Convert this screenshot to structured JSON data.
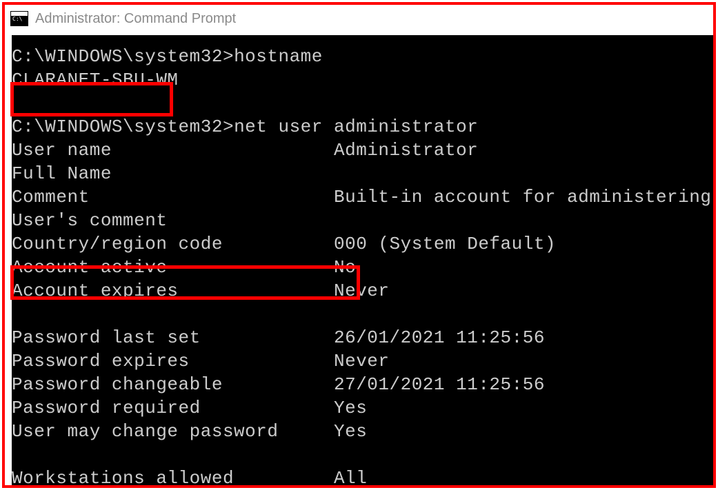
{
  "window": {
    "title": "Administrator: Command Prompt"
  },
  "prompt": "C:\\WINDOWS\\system32>",
  "cmd1": "hostname",
  "hostname": "CLARANET-SBU-WM",
  "cmd2": "net user administrator",
  "fields": {
    "user_name_label": "User name",
    "user_name_value": "Administrator",
    "full_name_label": "Full Name",
    "full_name_value": "",
    "comment_label": "Comment",
    "comment_value": "Built-in account for administering",
    "users_comment_label": "User's comment",
    "users_comment_value": "",
    "country_label": "Country/region code",
    "country_value": "000 (System Default)",
    "account_active_label": "Account active",
    "account_active_value": "No",
    "account_expires_label": "Account expires",
    "account_expires_value": "Never",
    "pw_last_set_label": "Password last set",
    "pw_last_set_value": "26/01/2021 11:25:56",
    "pw_expires_label": "Password expires",
    "pw_expires_value": "Never",
    "pw_changeable_label": "Password changeable",
    "pw_changeable_value": "27/01/2021 11:25:56",
    "pw_required_label": "Password required",
    "pw_required_value": "Yes",
    "user_may_change_label": "User may change password",
    "user_may_change_value": "Yes",
    "workstations_label": "Workstations allowed",
    "workstations_value": "All"
  }
}
